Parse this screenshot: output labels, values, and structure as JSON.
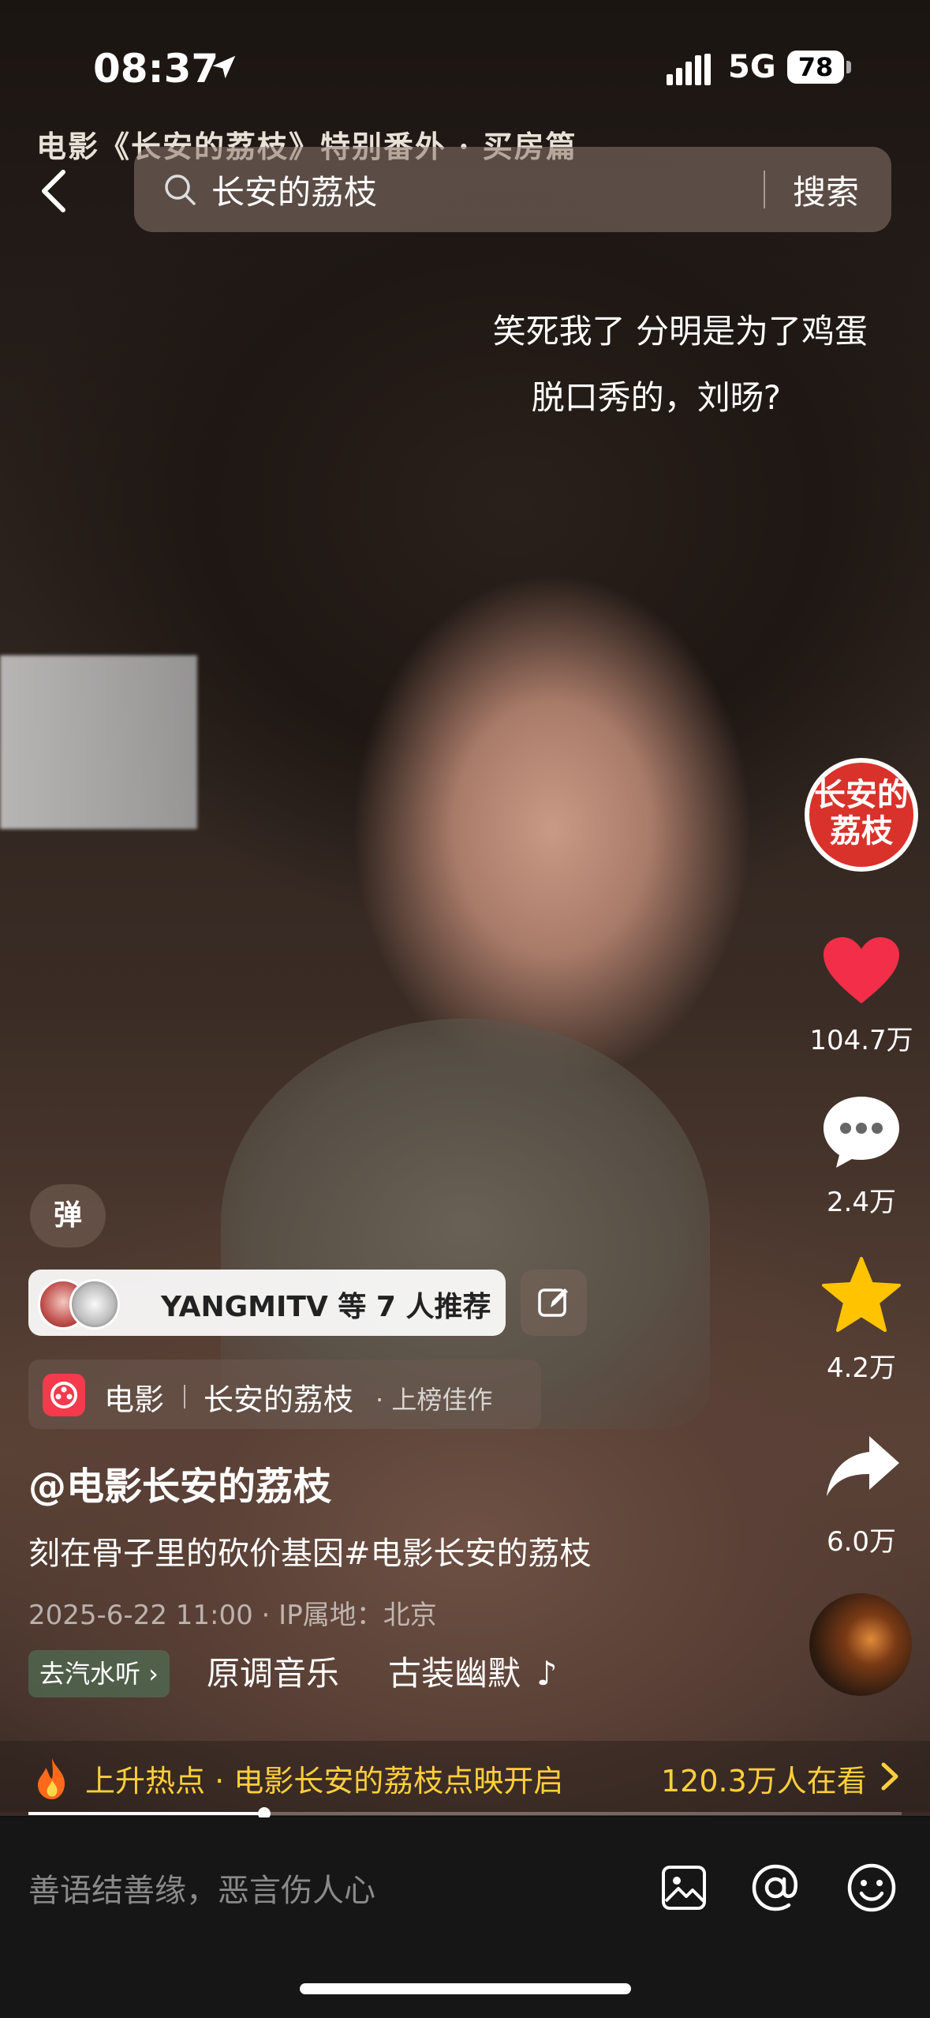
{
  "status_bar": {
    "time": "08:37",
    "network": "5G",
    "battery": "78"
  },
  "video": {
    "overlay_title": "电影《长安的荔枝》特别番外 · 买房篇",
    "subtitle_line1": "笑死我了 分明是为了鸡蛋",
    "subtitle_line2": "脱口秀的，刘旸?"
  },
  "search": {
    "query": "长安的荔枝",
    "button_label": "搜索"
  },
  "rail": {
    "avatar_text": "长安的荔枝",
    "likes": "104.7万",
    "comments": "2.4万",
    "favorites": "4.2万",
    "shares": "6.0万"
  },
  "danmaku": {
    "label": "弹"
  },
  "recommend": {
    "text": "YANGMITV 等 7 人推荐"
  },
  "category": {
    "name": "电影",
    "title": "长安的荔枝",
    "tag": "· 上榜佳作"
  },
  "post": {
    "author": "@电影长安的荔枝",
    "caption": "刻在骨子里的砍价基因#电影长安的荔枝",
    "meta": "2025-6-22 11:00 · IP属地：北京",
    "music_chip": "去汽水听 ›",
    "music_title": "原调音乐",
    "music_tag": "古装幽默",
    "music_note": "♪"
  },
  "hot": {
    "text": "上升热点 · 电影长安的荔枝点映开启",
    "count": "120.3万人在看"
  },
  "progress": {
    "fraction": 0.27
  },
  "bottom": {
    "input_placeholder": "善语结善缘，恶言伤人心"
  },
  "colors": {
    "like": "#f22e48",
    "star": "#ffc300",
    "hot_text": "#ffcf3a"
  }
}
